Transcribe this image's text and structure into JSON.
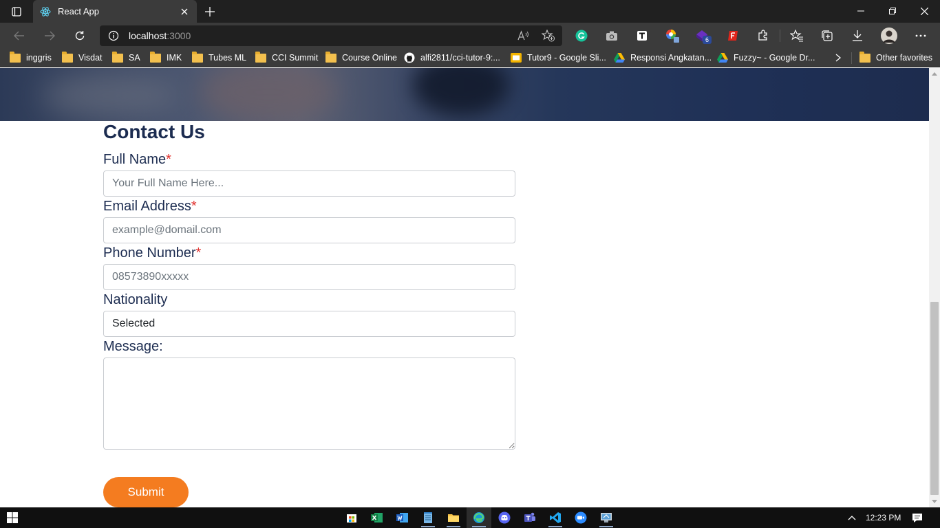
{
  "browser": {
    "tab": {
      "title": "React App",
      "favicon": "react-icon"
    },
    "address": {
      "host": "localhost",
      "port": ":3000"
    },
    "extensions": [
      "grammarly-icon",
      "camera-icon",
      "t-icon",
      "color-picker-icon",
      "badge-extension-icon",
      "flash-extension-icon",
      "puzzle-icon"
    ],
    "extension_badge": "6",
    "bookmarks": [
      {
        "label": "inggris",
        "icon": "folder-icon"
      },
      {
        "label": "Visdat",
        "icon": "folder-icon"
      },
      {
        "label": "SA",
        "icon": "folder-icon"
      },
      {
        "label": "IMK",
        "icon": "folder-icon"
      },
      {
        "label": "Tubes ML",
        "icon": "folder-icon"
      },
      {
        "label": "CCI Summit",
        "icon": "folder-icon"
      },
      {
        "label": "Course Online",
        "icon": "folder-icon"
      },
      {
        "label": "alfi2811/cci-tutor-9:...",
        "icon": "github-icon"
      },
      {
        "label": "Tutor9 - Google Sli...",
        "icon": "google-slides-icon"
      },
      {
        "label": "Responsi Angkatan...",
        "icon": "google-drive-icon"
      },
      {
        "label": "Fuzzy~ - Google Dr...",
        "icon": "google-drive-icon"
      }
    ],
    "other_favorites": "Other favorites"
  },
  "page": {
    "heading": "Contact Us",
    "required_mark": "*",
    "fields": {
      "full_name": {
        "label": "Full Name",
        "placeholder": "Your Full Name Here..."
      },
      "email": {
        "label": "Email Address",
        "placeholder": "example@domail.com"
      },
      "phone": {
        "label": "Phone Number",
        "placeholder": "08573890xxxxx"
      },
      "nationality": {
        "label": "Nationality",
        "value": "Selected"
      },
      "message": {
        "label": "Message:"
      }
    },
    "submit_label": "Submit"
  },
  "taskbar": {
    "apps": [
      "store-icon",
      "excel-icon",
      "word-icon",
      "notepad-icon",
      "file-explorer-icon",
      "edge-icon",
      "discord-icon",
      "teams-icon",
      "vscode-icon",
      "zoom-icon",
      "remote-desktop-icon"
    ],
    "time": "12:23 PM"
  },
  "colors": {
    "accent": "#f47c20",
    "heading": "#1c2c50",
    "required": "#e0302d"
  }
}
